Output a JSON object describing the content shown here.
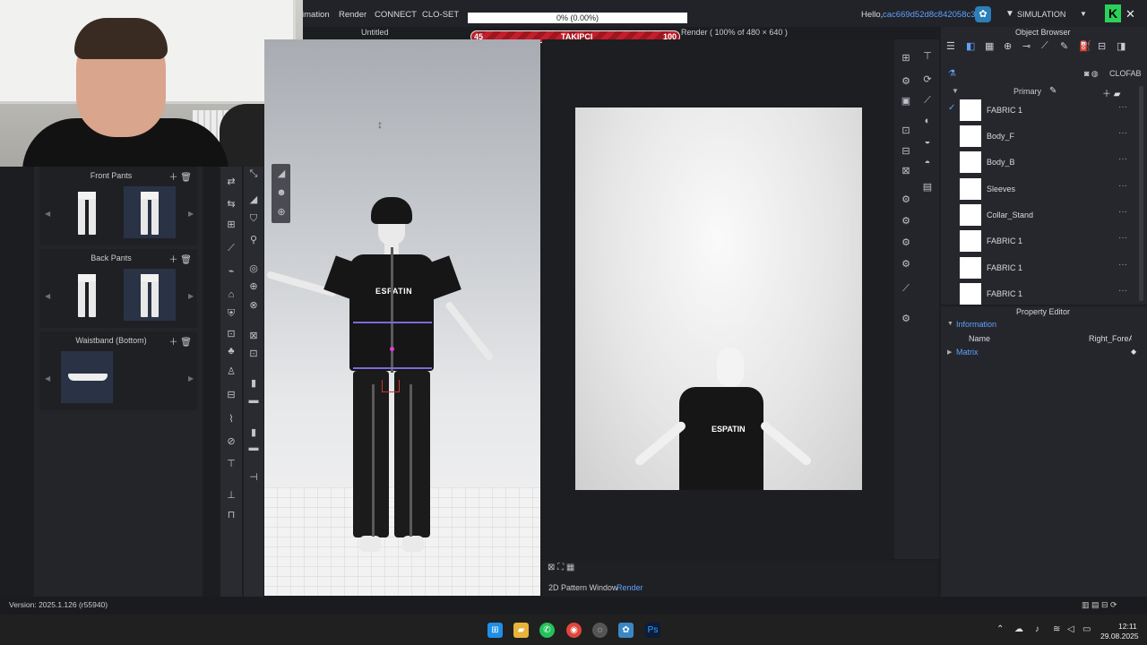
{
  "menu": {
    "items": [
      "imation",
      "Render",
      "CONNECT",
      "CLO-SET"
    ]
  },
  "overlay": {
    "progress_text": "0% (0.00%)",
    "follower_current": "45",
    "follower_label": "TAKIPÇI",
    "follower_goal": "100"
  },
  "account": {
    "hello": "Hello,",
    "user_id": "cac669d52d8c842058c3",
    "mode": "SIMULATION"
  },
  "viewport": {
    "title": "Untitled"
  },
  "render_panel": {
    "title": "Render ( 100% of 480 × 640 )",
    "tabs": [
      "2D Pattern Window",
      "Render"
    ],
    "print_text": "ESPATIN"
  },
  "library": {
    "sections": [
      {
        "title": "Front Pants"
      },
      {
        "title": "Back Pants"
      },
      {
        "title": "Waistband (Bottom)"
      }
    ]
  },
  "avatar": {
    "shirt_print": "ESPATIN"
  },
  "object_browser": {
    "title": "Object Browser",
    "clofab": "CLOFAB",
    "primary": "Primary",
    "fabrics": [
      "FABRIC 1",
      "Body_F",
      "Body_B",
      "Sleeves",
      "Collar_Stand",
      "FABRIC 1",
      "FABRIC 1",
      "FABRIC 1"
    ]
  },
  "property_editor": {
    "title": "Property Editor",
    "information": "Information",
    "name_key": "Name",
    "name_value": "Right_ForeArm",
    "matrix": "Matrix"
  },
  "status": {
    "version": "Version: 2025.1.126 (r55940)"
  },
  "taskbar": {
    "time": "12:11",
    "date": "29.08.2025"
  },
  "colors": {
    "accent": "#5ea1ff",
    "follower_bar": "#c41e2a",
    "kick_green": "#2bd15b"
  }
}
